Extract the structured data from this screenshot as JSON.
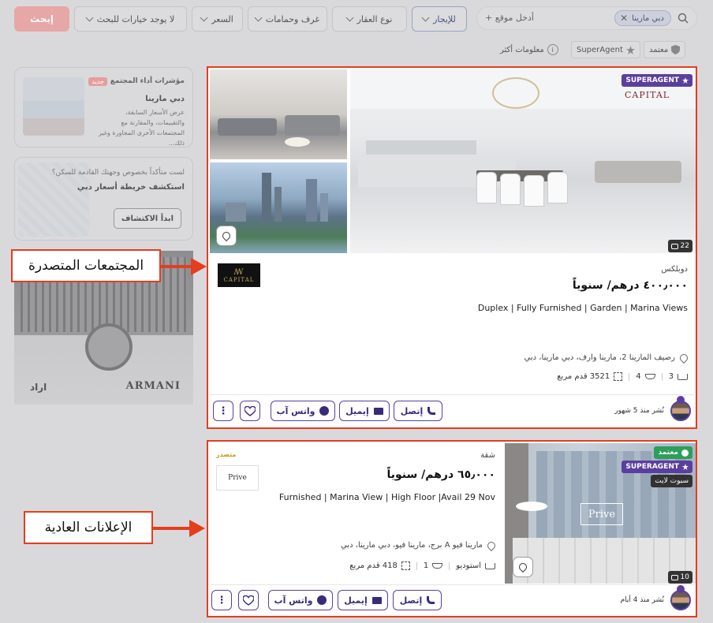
{
  "topbar": {
    "search_chip": "دبي مارينا",
    "location_placeholder": "أدخل موقع +",
    "filters": [
      {
        "label": "للإيجار",
        "active": true
      },
      {
        "label": "نوع العقار",
        "active": false
      },
      {
        "label": "غرف وحمامات",
        "active": false
      },
      {
        "label": "السعر",
        "active": false
      },
      {
        "label": "لا يوجد خيارات للبحث",
        "active": false
      }
    ],
    "search_button": "إبحث"
  },
  "badges": {
    "verified": "معتمد",
    "superagent": "SuperAgent",
    "more_info": "معلومات أكثر"
  },
  "sidebar": {
    "insights": {
      "title": "مؤشرات أداء المجتمع",
      "new_tag": "جديد",
      "location": "دبي مارينا",
      "description": "عرض الأسعار السابقة، والتقييمات، والمقارنة مع المجتمعات الأخرى المجاورة وغير ذلك..."
    },
    "map_promo": {
      "line1": "لست متأكداً بخصوص وجهتك القادمة للسكن؟",
      "line2": "استكشف خريطة أسعار دبي",
      "button": "ابدأ الاكتشاف"
    },
    "ad": {
      "brand_left": "اراد",
      "brand_right": "ARMANI"
    }
  },
  "annotations": {
    "featured": "المجتمعات المتصدرة",
    "regular": "الإعلانات العادية"
  },
  "listings": [
    {
      "superagent_badge": "SUPERAGENT",
      "photo_count": "22",
      "property_type": "دوبلكس",
      "price": "٤٠٠٫٠٠٠ درهم/ سنوياً",
      "title": "Duplex | Fully Furnished | Garden | Marina Views",
      "location": "رصيف المارينا 2، مارينا وارف، دبي مارينا، دبي",
      "beds": "3",
      "baths": "4",
      "area": "3521 قدم مربع",
      "posted": "نُشر منذ 5 شهور",
      "actions": {
        "call": "إتصل",
        "email": "إيميل",
        "whatsapp": "واتس آب"
      },
      "logo_text": "CAPITAL",
      "photo_brand": "CAPITAL"
    },
    {
      "verified_badge": "معتمد",
      "superagent_badge": "SUPERAGENT",
      "live_badge": "سبوت لايت",
      "photo_count": "10",
      "featured_tag": "متصدر",
      "property_type": "شقة",
      "price": "٦٥٫٠٠٠ درهم/ سنوياً",
      "title": "Furnished | Marina View | High Floor |Avail 29 Nov",
      "location": "مارينا فيو A برج، مارينا فيو، دبي مارينا، دبي",
      "beds": "استوديو",
      "baths": "1",
      "area": "418 قدم مربع",
      "posted": "نُشر منذ 4 أيام",
      "actions": {
        "call": "إتصل",
        "email": "إيميل",
        "whatsapp": "واتس آب"
      },
      "logo_text": "Prive",
      "photo_brand": "Prive"
    }
  ]
}
